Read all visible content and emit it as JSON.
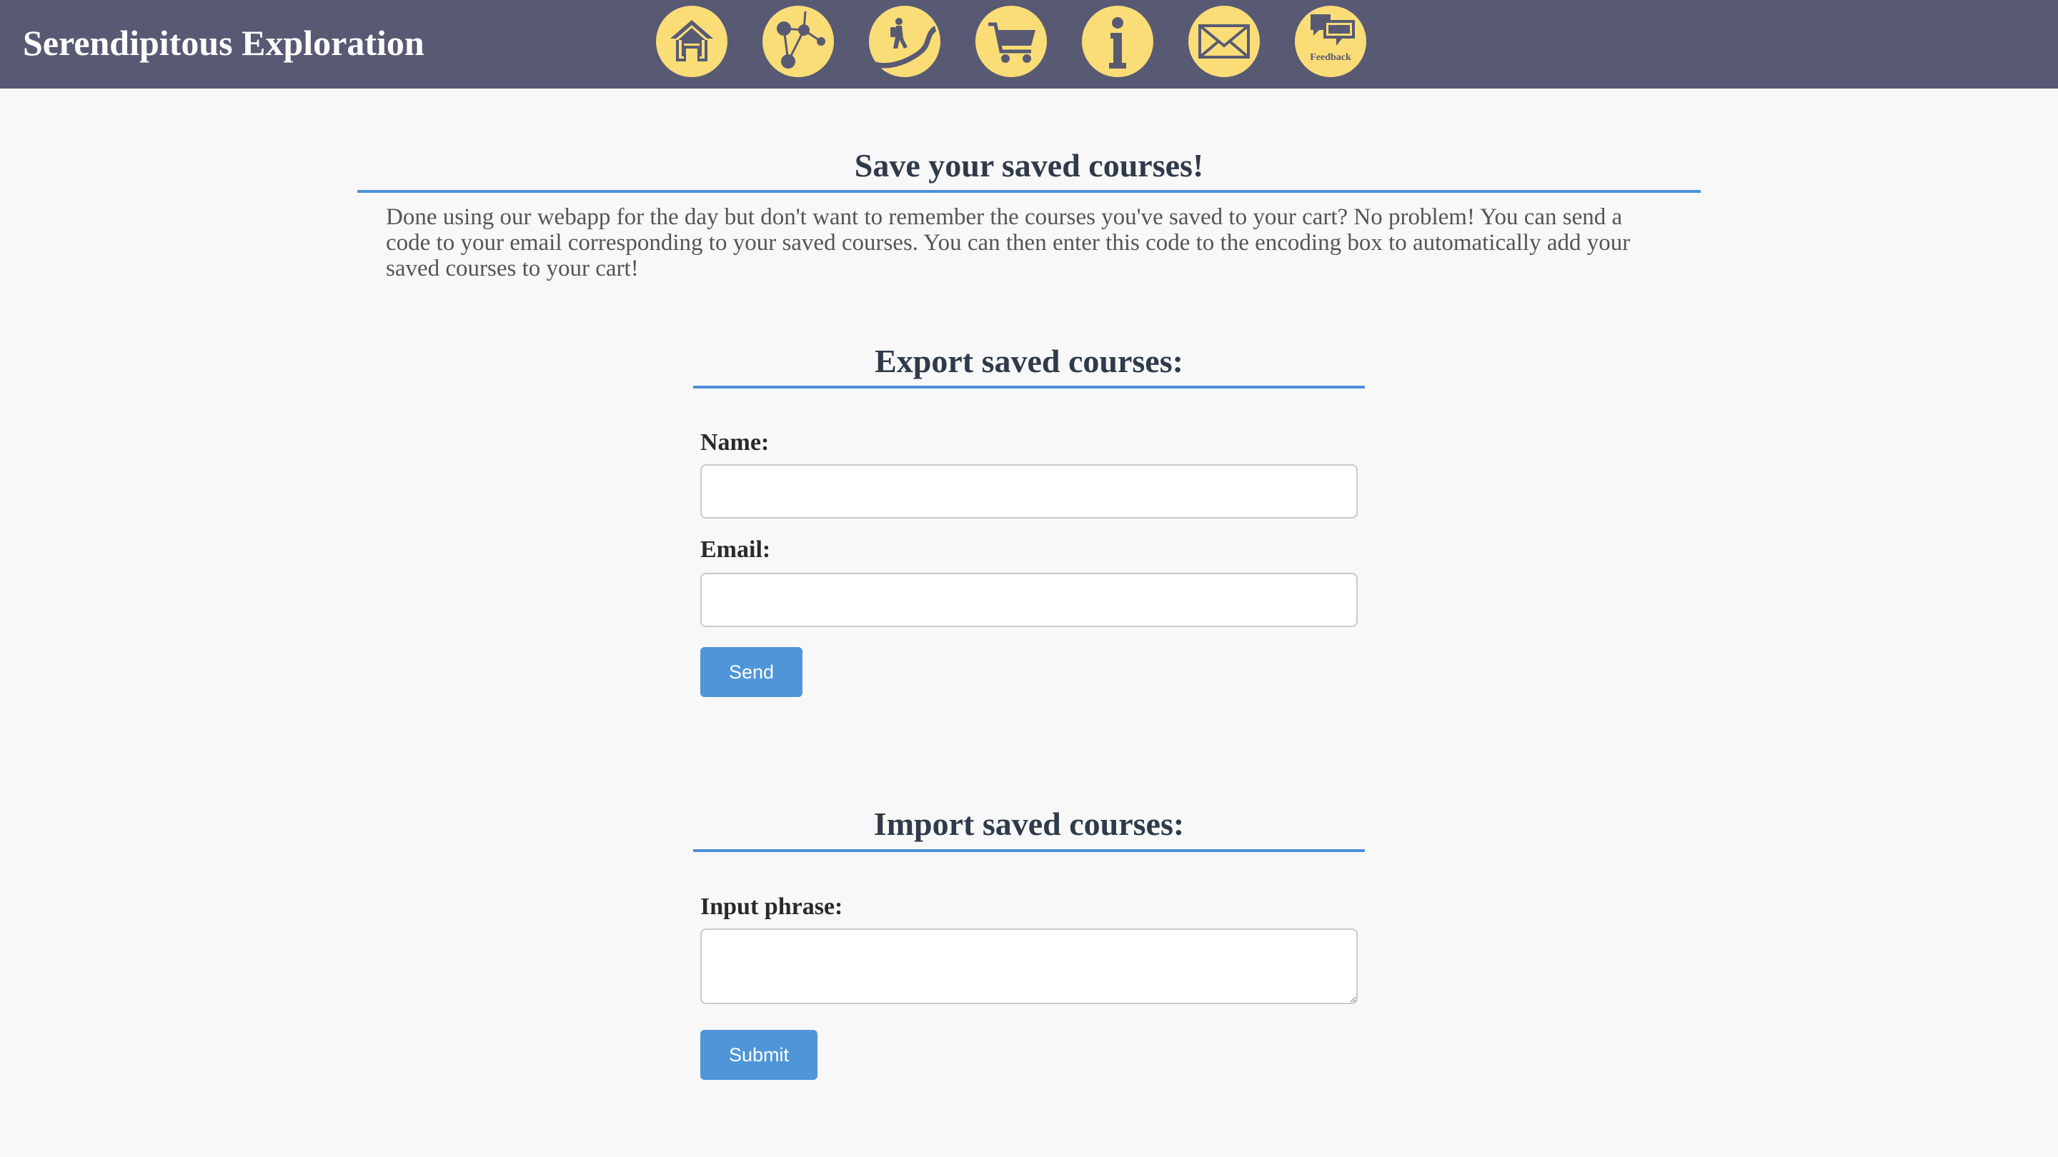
{
  "header": {
    "brand": "Serendipitous Exploration",
    "nav": [
      {
        "name": "home",
        "icon": "home-icon"
      },
      {
        "name": "network",
        "icon": "network-graph-icon"
      },
      {
        "name": "path",
        "icon": "hiker-path-icon"
      },
      {
        "name": "cart",
        "icon": "shopping-cart-icon"
      },
      {
        "name": "info",
        "icon": "info-icon"
      },
      {
        "name": "mail",
        "icon": "envelope-icon"
      },
      {
        "name": "feedback",
        "icon": "feedback-icon",
        "label": "Feedback"
      }
    ],
    "nav_color": "#fbdd77",
    "bar_color": "#585a74"
  },
  "main": {
    "title": "Save your saved courses!",
    "intro": "Done using our webapp for the day but don't want to remember the courses you've saved to your cart? No problem! You can send a code to your email corresponding to your saved courses. You can then enter this code to the encoding box to automatically add your saved courses to your cart!"
  },
  "export": {
    "title": "Export saved courses:",
    "name_label": "Name:",
    "name_value": "",
    "email_label": "Email:",
    "email_value": "",
    "send_label": "Send"
  },
  "import": {
    "title": "Import saved courses:",
    "phrase_label": "Input phrase:",
    "phrase_value": "",
    "submit_label": "Submit"
  },
  "colors": {
    "accent": "#4f96d8",
    "rule": "#4d91d6"
  }
}
